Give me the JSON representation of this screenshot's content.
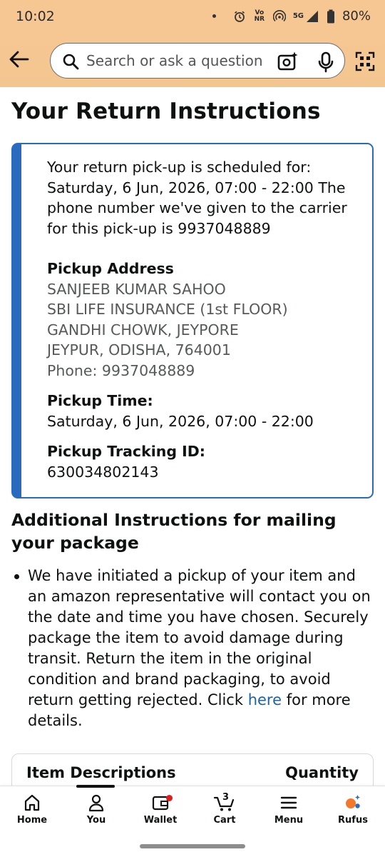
{
  "status_bar": {
    "time": "10:02",
    "network_label": "5G",
    "volte_label": "Vo NR",
    "battery": "80%"
  },
  "header": {
    "search_placeholder": "Search or ask a question",
    "icons": [
      "back-arrow-icon",
      "search-icon",
      "camera-sparkle-icon",
      "microphone-icon",
      "qr-code-icon"
    ]
  },
  "page": {
    "title": "Your Return Instructions"
  },
  "instructions": {
    "scheduled_text": "Your return pick-up is scheduled for: Saturday, 6 Jun, 2026, 07:00 - 22:00 The phone number we've given to the carrier for this pick-up is 9937048889",
    "address_heading": "Pickup Address",
    "address_lines": [
      "SANJEEB KUMAR SAHOO",
      "SBI LIFE INSURANCE (1st FLOOR)",
      "GANDHI CHOWK, JEYPORE",
      "JEYPUR, ODISHA, 764001",
      "Phone: 9937048889"
    ],
    "time_heading": "Pickup Time:",
    "time_value": "Saturday, 6 Jun, 2026, 07:00 - 22:00",
    "tracking_heading": "Pickup Tracking ID:",
    "tracking_value": "630034802143"
  },
  "additional": {
    "title": "Additional Instructions for mailing your package",
    "bullet_text_before": "We have initiated a pickup of your item and an amazon representative will contact you on the date and time you have chosen. Securely package the item to avoid damage during transit. Return the item in the original condition and brand packaging, to avoid return getting rejected. Click ",
    "bullet_link": "here",
    "bullet_text_after": " for more details."
  },
  "items_table": {
    "col_items": "Item Descriptions",
    "col_quantity": "Quantity"
  },
  "bottom_nav": {
    "home": "Home",
    "you": "You",
    "wallet": "Wallet",
    "cart": "Cart",
    "cart_count": "3",
    "menu": "Menu",
    "rufus": "Rufus",
    "active": "You"
  },
  "colors": {
    "header_bg": "#f6c793",
    "card_border": "#2a6bbf",
    "link": "#2162a1",
    "badge": "#e01e1e",
    "rufus_orange": "#f3782c",
    "rufus_blue": "#2a6bbf"
  }
}
